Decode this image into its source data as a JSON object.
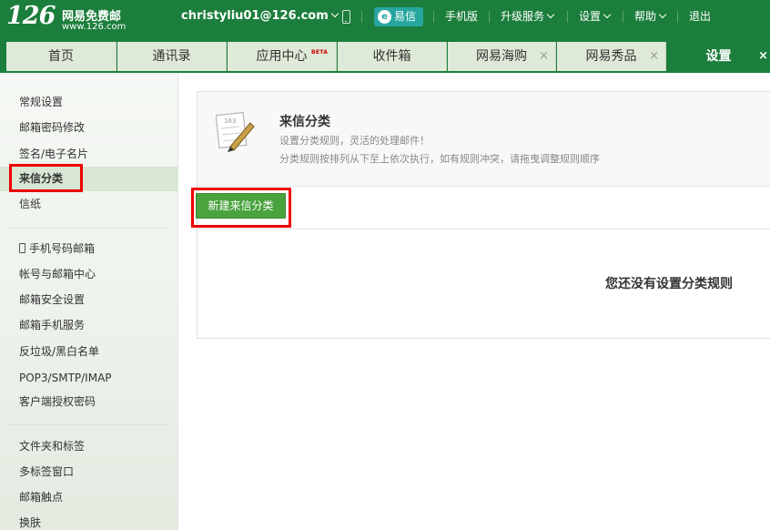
{
  "brand": {
    "logo_number": "126",
    "name": "网易免费邮",
    "url": "www.126.com"
  },
  "topbar": {
    "user_email": "christyliu01@126.com",
    "yixin_label": "易信",
    "yixin_icon": "yixin-icon",
    "mobile_label": "手机版",
    "upgrade_label": "升级服务",
    "settings_label": "设置",
    "help_label": "帮助",
    "logout_label": "退出"
  },
  "tabs": [
    {
      "label": "首页"
    },
    {
      "label": "通讯录"
    },
    {
      "label": "应用中心",
      "badge": "BETA"
    },
    {
      "label": "收件箱"
    },
    {
      "label": "网易海购",
      "closable": true
    },
    {
      "label": "网易秀品",
      "closable": true
    },
    {
      "label": "设置",
      "closable": true,
      "active": true
    }
  ],
  "sidebar": {
    "group1": [
      "常规设置",
      "邮箱密码修改",
      "签名/电子名片",
      "来信分类",
      "信纸"
    ],
    "group2": [
      "手机号码邮箱",
      "帐号与邮箱中心",
      "邮箱安全设置",
      "邮箱手机服务",
      "反垃圾/黑白名单",
      "POP3/SMTP/IMAP",
      "客户端授权密码"
    ],
    "group3": [
      "文件夹和标签",
      "多标签窗口",
      "邮箱触点",
      "换肤"
    ],
    "selected": "来信分类"
  },
  "main": {
    "title": "来信分类",
    "desc1": "设置分类规则，灵活的处理邮件！",
    "desc2": "分类规则按排列从下至上依次执行，如有规则冲突，请拖曳调整规则顺序",
    "icon_text": "163",
    "new_button": "新建来信分类",
    "empty_message": "您还没有设置分类规则"
  },
  "colors": {
    "brand_green": "#1c7e3c",
    "button_green": "#4aa33e",
    "highlight_red": "#e00000",
    "tab_bg": "#dfe9d8"
  },
  "close_glyph": "×"
}
